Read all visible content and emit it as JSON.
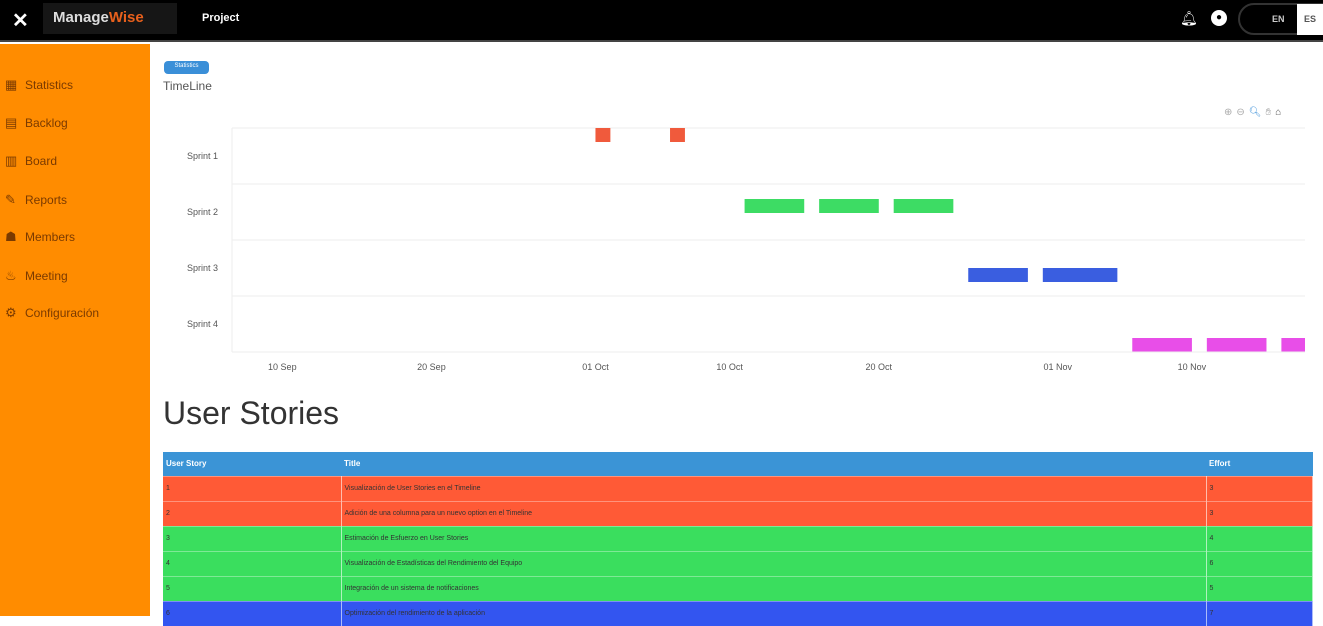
{
  "header": {
    "close": "✕",
    "logo_a": "Manage",
    "logo_b": "Wise",
    "project": "Project",
    "lang_en": "EN",
    "lang_es": "ES"
  },
  "sidebar": {
    "items": [
      {
        "label": "Statistics",
        "icon": "▦"
      },
      {
        "label": "Backlog",
        "icon": "▤"
      },
      {
        "label": "Board",
        "icon": "▥"
      },
      {
        "label": "Reports",
        "icon": "✎"
      },
      {
        "label": "Members",
        "icon": "☗"
      },
      {
        "label": "Meeting",
        "icon": "♨"
      },
      {
        "label": "Configuración",
        "icon": "⚙"
      }
    ]
  },
  "main": {
    "badge": "Statistics",
    "timeline_title": "TimeLine",
    "stories_title": "User Stories"
  },
  "chart_data": {
    "type": "timeline",
    "categories": [
      "Sprint 1",
      "Sprint 2",
      "Sprint 3",
      "Sprint 4"
    ],
    "x_ticks": [
      {
        "label": "10 Sep",
        "date": "2023-09-10"
      },
      {
        "label": "20 Sep",
        "date": "2023-09-20"
      },
      {
        "label": "01 Oct",
        "date": "2023-10-01"
      },
      {
        "label": "10 Oct",
        "date": "2023-10-10"
      },
      {
        "label": "20 Oct",
        "date": "2023-10-20"
      },
      {
        "label": "01 Nov",
        "date": "2023-11-01"
      },
      {
        "label": "10 Nov",
        "date": "2023-11-10"
      }
    ],
    "xlim": [
      "2023-09-06T15:00",
      "2023-11-17T14:00"
    ],
    "series": [
      {
        "name": "Sprint 1",
        "color": "#f05a3c",
        "bars": [
          [
            "2023-10-01",
            "2023-10-02"
          ],
          [
            "2023-10-06",
            "2023-10-07"
          ]
        ]
      },
      {
        "name": "Sprint 2",
        "color": "#3ddc64",
        "bars": [
          [
            "2023-10-11",
            "2023-10-15"
          ],
          [
            "2023-10-16",
            "2023-10-20"
          ],
          [
            "2023-10-21",
            "2023-10-25"
          ]
        ]
      },
      {
        "name": "Sprint 3",
        "color": "#3a5ee0",
        "bars": [
          [
            "2023-10-26",
            "2023-10-30"
          ],
          [
            "2023-10-31",
            "2023-11-05"
          ]
        ]
      },
      {
        "name": "Sprint 4",
        "color": "#e84ee8",
        "bars": [
          [
            "2023-11-06",
            "2023-11-10"
          ],
          [
            "2023-11-11",
            "2023-11-15"
          ],
          [
            "2023-11-16",
            "2023-11-20"
          ]
        ]
      }
    ]
  },
  "table": {
    "headers": [
      "User Story",
      "Title",
      "Effort"
    ],
    "rows": [
      {
        "id": "1",
        "title": "Visualización de User Stories en el Timeline",
        "effort": "3",
        "color": "#ff5a36"
      },
      {
        "id": "2",
        "title": "Adición de una columna para un nuevo option en el Timeline",
        "effort": "3",
        "color": "#ff5a36"
      },
      {
        "id": "3",
        "title": "Estimación de Esfuerzo en User Stories",
        "effort": "4",
        "color": "#3ade5e"
      },
      {
        "id": "4",
        "title": "Visualización de Estadísticas del Rendimiento del Equipo",
        "effort": "6",
        "color": "#3ade5e"
      },
      {
        "id": "5",
        "title": "Integración de un sistema de notificaciones",
        "effort": "5",
        "color": "#3ade5e"
      },
      {
        "id": "6",
        "title": "Optimización del rendimiento de la aplicación",
        "effort": "7",
        "color": "#3355f0"
      }
    ]
  }
}
